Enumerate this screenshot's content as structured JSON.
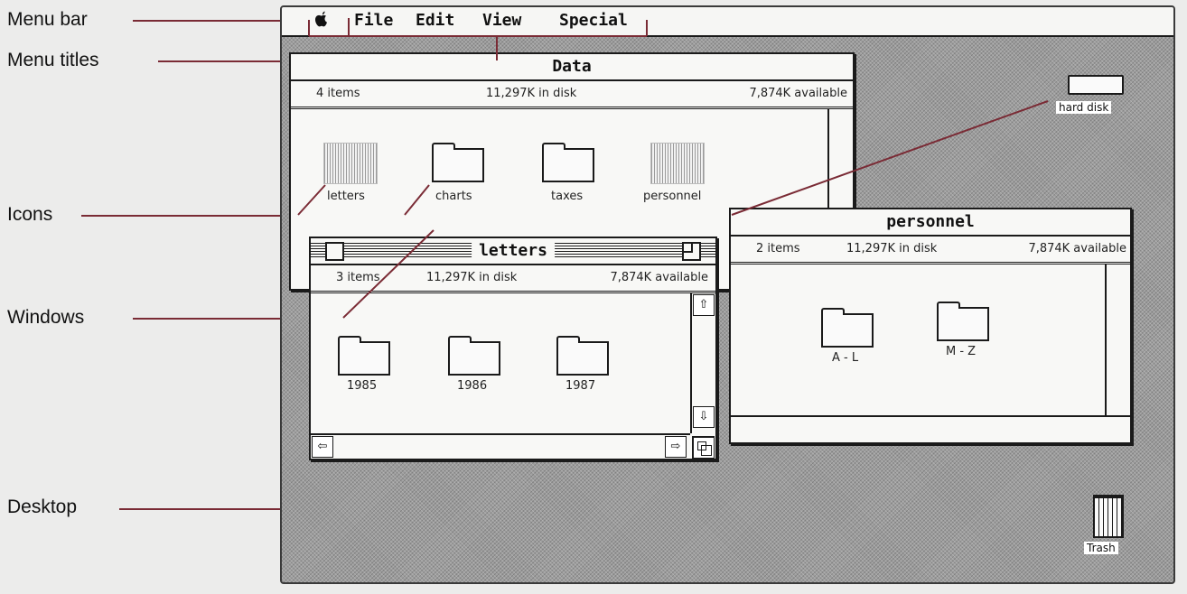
{
  "callouts": {
    "menu_bar": "Menu bar",
    "menu_titles": "Menu titles",
    "icons": "Icons",
    "windows": "Windows",
    "desktop": "Desktop"
  },
  "menubar": {
    "apple_icon": "apple-logo-icon",
    "apple": "",
    "items": [
      "File",
      "Edit",
      "View",
      "Special"
    ]
  },
  "data_window": {
    "title": "Data",
    "items": "4 items",
    "disk": "11,297K in disk",
    "available": "7,874K available",
    "icons": [
      {
        "label": "letters",
        "icon": "document-icon"
      },
      {
        "label": "charts",
        "icon": "folder-icon"
      },
      {
        "label": "taxes",
        "icon": "folder-icon"
      },
      {
        "label": "personnel",
        "icon": "document-icon"
      }
    ]
  },
  "letters_window": {
    "title": "letters",
    "items": "3 items",
    "disk": "11,297K in disk",
    "available": "7,874K available",
    "folders": [
      "1985",
      "1986",
      "1987"
    ]
  },
  "personnel_window": {
    "title": "personnel",
    "items": "2 items",
    "disk": "11,297K in disk",
    "available": "7,874K available",
    "folders": [
      "A - L",
      "M - Z"
    ]
  },
  "desktop": {
    "hard_disk": "hard disk",
    "trash": "Trash"
  },
  "colors": {
    "leader_lines": "#7a2b35",
    "desktop": "#9c9c9c"
  }
}
